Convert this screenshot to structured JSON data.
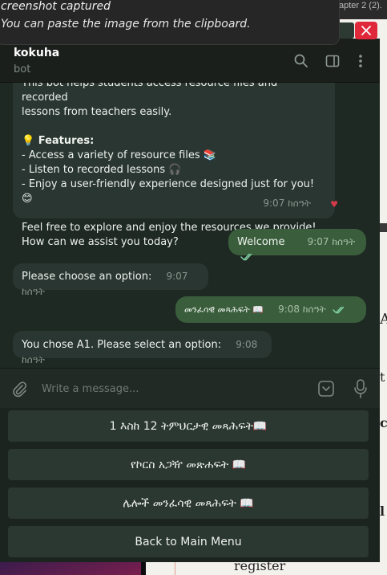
{
  "toast": {
    "title": "creenshot captured",
    "body": "You can paste the image from the clipboard."
  },
  "background": {
    "topbar_text": "apter 2 (2).",
    "register_word": "register"
  },
  "chat": {
    "name": "kokuha",
    "status": "bot"
  },
  "welcome_message": {
    "line_intro_1": "This bot helps students access resource files and recorded",
    "line_intro_2": "lessons from teachers easily.",
    "features_heading": "💡 Features:",
    "feature_1": "- Access a variety of resource files 📚",
    "feature_2": "- Listen to recorded lessons 🎧",
    "feature_3": "- Enjoy a user-friendly experience designed just for you! 😊",
    "closing_1": "Feel free to explore and enjoy the resources we provide!",
    "closing_2": "How can we assist you today?",
    "time": "9:07 ከሰዓት",
    "reaction": "♥"
  },
  "messages": [
    {
      "text": "Welcome",
      "time": "9:07 ከሰዓት"
    },
    {
      "text": "Please choose an option:",
      "time": "9:07 ከሰዓት"
    },
    {
      "text": "መንፈሳዊ መጻሕፍት 📖",
      "time": "9:08 ከሰዓት"
    },
    {
      "text": "You chose A1. Please select an option:",
      "time": "9:08 ከሰዓት"
    }
  ],
  "input": {
    "placeholder": "Write a message..."
  },
  "keyboard": {
    "buttons": [
      "1 እስከ 12 ትምህርታዊ መጻሕፍት📖",
      "የኮርስ አጋዥ መጽሐፍት 📖",
      "ሌሎች መንፈሳዊ መጻሕፍት 📖",
      "Back to Main Menu"
    ]
  },
  "colors": {
    "accent_outgoing": "#3a5e3c",
    "close_button": "#e0283b",
    "ticks": "#7fd0a0"
  },
  "icons": [
    "search-icon",
    "sidebar-toggle-icon",
    "more-vertical-icon",
    "close-icon",
    "paperclip-icon",
    "emoji-sticker-icon",
    "microphone-icon",
    "double-check-icon"
  ]
}
